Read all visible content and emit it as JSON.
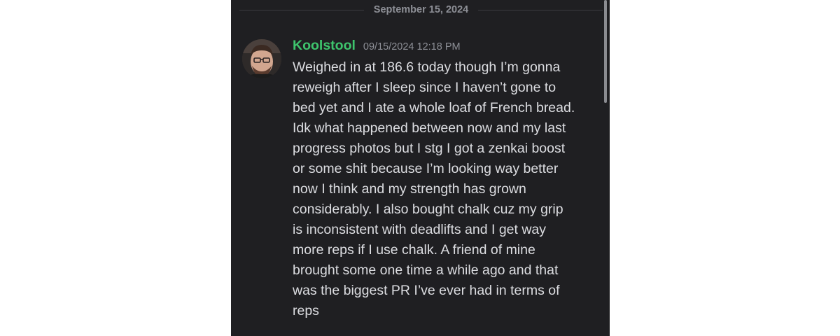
{
  "divider": {
    "date": "September 15, 2024"
  },
  "message": {
    "username": "Koolstool",
    "timestamp": "09/15/2024 12:18 PM",
    "lines": [
      "Weighed in at 186.6 today though I’m gonna",
      "reweigh after I sleep since I haven’t gone to",
      "bed yet and I ate a whole loaf of French bread.",
      "Idk what happened between now and my last",
      "progress photos but I stg I got a zenkai boost",
      "or some shit because I’m looking way better",
      "now I think and my strength has grown",
      "considerably. I also bought chalk cuz my grip",
      "is inconsistent with deadlifts and I get way",
      "more reps if I use chalk. A friend of mine",
      "brought some one time a while ago and that",
      "was the biggest PR I’ve ever had in terms of",
      "reps"
    ],
    "avatar_icon": "user-avatar-photo"
  },
  "colors": {
    "background": "#1f1f22",
    "username": "#3ec46d",
    "text": "#dcdde1",
    "muted": "#8d8f96"
  }
}
